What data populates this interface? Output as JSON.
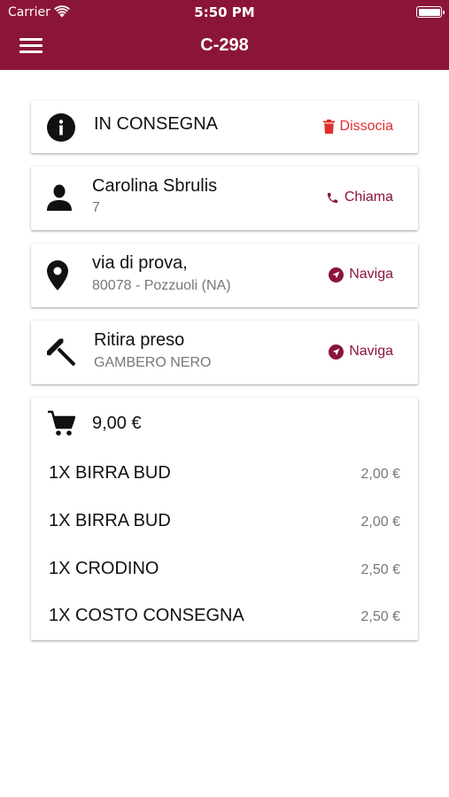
{
  "status_bar": {
    "carrier": "Carrier",
    "time": "5:50 PM"
  },
  "header": {
    "title": "C-298"
  },
  "colors": {
    "primary": "#8b1538",
    "danger": "#e0302e",
    "text": "#111111",
    "muted": "#777777"
  },
  "status_card": {
    "icon": "info-icon",
    "status": "IN CONSEGNA",
    "action_label": "Dissocia",
    "action_icon": "trash-icon"
  },
  "customer_card": {
    "icon": "person-icon",
    "name": "Carolina Sbrulis",
    "detail": "7",
    "action_label": "Chiama",
    "action_icon": "phone-icon"
  },
  "address_card": {
    "icon": "location-pin-icon",
    "street": "via di prova,",
    "city": "80078 - Pozzuoli (NA)",
    "action_label": "Naviga",
    "action_icon": "navigation-icon"
  },
  "pickup_card": {
    "icon": "hammer-icon",
    "label": "Ritira preso",
    "place": "GAMBERO NERO",
    "action_label": "Naviga",
    "action_icon": "navigation-icon"
  },
  "order_card": {
    "icon": "cart-icon",
    "total": "9,00 €",
    "items": [
      {
        "name": "1X BIRRA BUD",
        "price": "2,00 €"
      },
      {
        "name": "1X BIRRA BUD",
        "price": "2,00 €"
      },
      {
        "name": "1X CRODINO",
        "price": "2,50 €"
      },
      {
        "name": "1X COSTO CONSEGNA",
        "price": "2,50 €"
      }
    ]
  }
}
